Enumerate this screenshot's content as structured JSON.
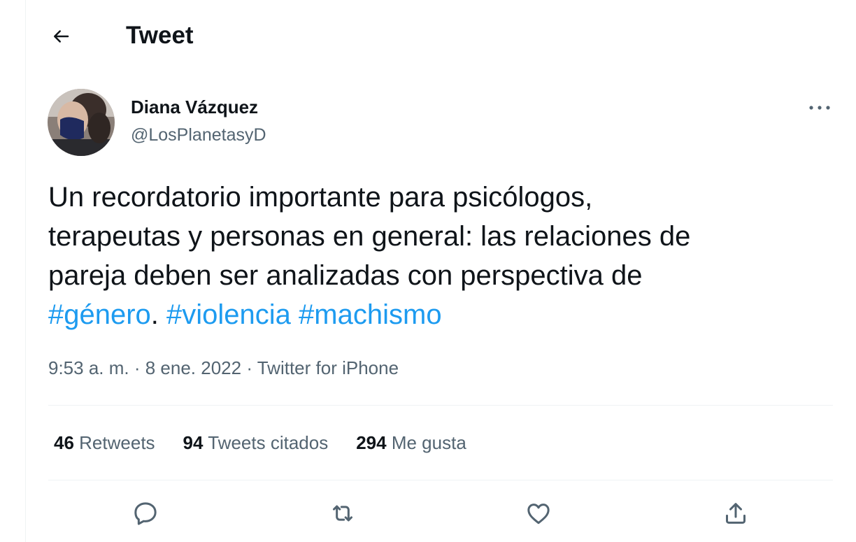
{
  "header": {
    "title": "Tweet"
  },
  "author": {
    "name": "Diana Vázquez",
    "handle": "@LosPlanetasyD"
  },
  "tweet": {
    "line1": "Un recordatorio importante para psicólogos,",
    "line2": "terapeutas y personas en general: las relaciones de",
    "line3": "pareja deben ser analizadas con perspectiva de",
    "hashtag1": "#género",
    "after_hashtag1": ". ",
    "hashtag2": "#violencia",
    "hashtag3": "#machismo"
  },
  "meta": {
    "time": "9:53 a. m.",
    "sep1": " · ",
    "date": "8 ene. 2022",
    "sep2": " · ",
    "source": "Twitter for iPhone"
  },
  "stats": {
    "retweets_count": "46",
    "retweets_label": "Retweets",
    "quotes_count": "94",
    "quotes_label": "Tweets citados",
    "likes_count": "294",
    "likes_label": "Me gusta"
  },
  "icons": {
    "back": "arrow-left-icon",
    "more": "more-horizontal-icon",
    "reply": "reply-icon",
    "retweet": "retweet-icon",
    "like": "heart-icon",
    "share": "share-icon"
  },
  "colors": {
    "hashtag": "#1d9bf0",
    "secondary_text": "#536471",
    "primary_text": "#0f1419",
    "divider": "#eff3f4"
  }
}
